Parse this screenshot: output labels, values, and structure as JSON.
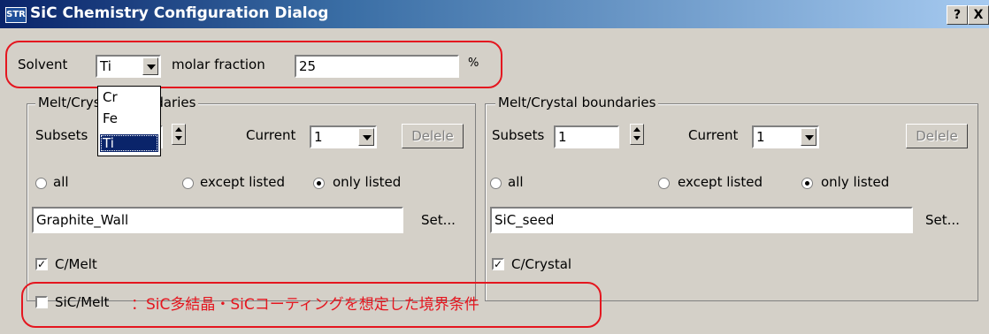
{
  "window": {
    "app_icon_text": "STR",
    "title": "SiC Chemistry Configuration Dialog",
    "help_label": "?",
    "close_label": "X"
  },
  "solvent": {
    "label": "Solvent",
    "selected": "Ti",
    "molar_label": "molar fraction",
    "molar_value": "25",
    "unit": "%",
    "dropdown_options": [
      "Cr",
      "Fe",
      "Ti"
    ]
  },
  "left_group": {
    "legend": "Melt/Crystal boundaries",
    "subsets_label": "Subsets",
    "subsets_value": "",
    "current_label": "Current",
    "current_value": "1",
    "delete_label": "Delele",
    "radio_all": "all",
    "radio_except": "except listed",
    "radio_only": "only listed",
    "selected_radio": "only listed",
    "list_value": "Graphite_Wall",
    "set_label": "Set...",
    "check1_label": "C/Melt",
    "check1_checked": true,
    "check2_label": "SiC/Melt",
    "check2_checked": false
  },
  "right_group": {
    "legend": "Melt/Crystal boundaries",
    "subsets_label": "Subsets",
    "subsets_value": "1",
    "current_label": "Current",
    "current_value": "1",
    "delete_label": "Delele",
    "radio_all": "all",
    "radio_except": "except listed",
    "radio_only": "only listed",
    "selected_radio": "only listed",
    "list_value": "SiC_seed",
    "set_label": "Set...",
    "check1_label": "C/Crystal",
    "check1_checked": true
  },
  "annotation": {
    "text": "：SiC多結晶・SiCコーティングを想定した境界条件",
    "color": "#e4161f"
  },
  "colors": {
    "dialog_bg": "#d4d0c8",
    "title_dark": "#0a246a",
    "title_light": "#a6caf0",
    "highlight": "#0a246a",
    "annotation_red": "#e4161f"
  }
}
